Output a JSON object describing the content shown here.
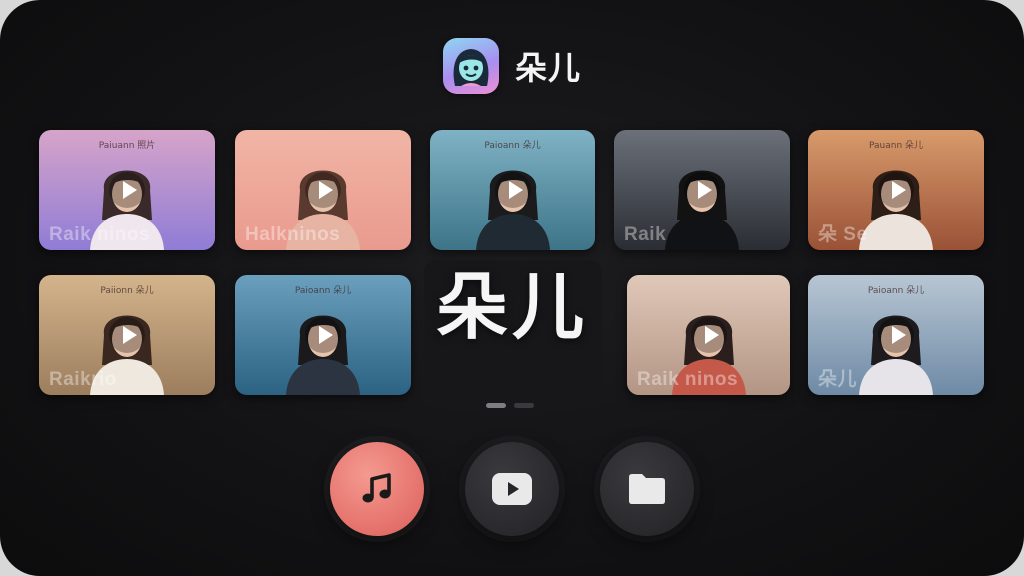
{
  "app": {
    "title": "朵儿",
    "center_label": "朵儿",
    "icon": "cartoon-girl-avatar-icon"
  },
  "videos": [
    {
      "caption": "Paiuann 照片",
      "watermark": "Raik ninos",
      "bg": [
        "#8f7cd6",
        "#d6a4c9"
      ],
      "shirt": "#efe6ee",
      "hair": "#3b2a2a"
    },
    {
      "caption": "",
      "watermark": "Halkninos",
      "bg": [
        "#e99a8e",
        "#f1b5a5"
      ],
      "shirt": "#e7b3a3",
      "hair": "#5a3a2e"
    },
    {
      "caption": "Paioann 朵儿",
      "watermark": "",
      "bg": [
        "#3d7488",
        "#7fb2c4"
      ],
      "shirt": "#1f2a33",
      "hair": "#1b1b1e"
    },
    {
      "caption": "",
      "watermark": "Raik",
      "bg": [
        "#2a2d33",
        "#6b7079"
      ],
      "shirt": "#101216",
      "hair": "#121212"
    },
    {
      "caption": "Pauann 朵儿",
      "watermark": "朵 Se",
      "bg": [
        "#9a5237",
        "#d89a6b"
      ],
      "shirt": "#ece4dc",
      "hair": "#2e1e18"
    },
    {
      "caption": "Paiionn 朵儿",
      "watermark": "Raikrio",
      "bg": [
        "#9c7e5e",
        "#d4b48c"
      ],
      "shirt": "#efe8de",
      "hair": "#3a2820"
    },
    {
      "caption": "Paioann 朵儿",
      "watermark": "",
      "bg": [
        "#2c6282",
        "#6aa0bd"
      ],
      "shirt": "#2b3440",
      "hair": "#1a1a1d"
    },
    {
      "caption": "",
      "watermark": "Raik ninos",
      "bg": [
        "#b39584",
        "#e0c8b8"
      ],
      "shirt": "#c4594a",
      "hair": "#2a1f1c"
    },
    {
      "caption": "Paioann 朵儿",
      "watermark": "朵儿",
      "bg": [
        "#6e8aa6",
        "#b8c6d3"
      ],
      "shirt": "#e6e4e8",
      "hair": "#1d1b1d"
    }
  ],
  "pager": {
    "pages": 2,
    "active": 0
  },
  "dock": [
    {
      "name": "music",
      "icon": "music-note-icon"
    },
    {
      "name": "video",
      "icon": "play-icon"
    },
    {
      "name": "folder",
      "icon": "folder-icon"
    }
  ]
}
